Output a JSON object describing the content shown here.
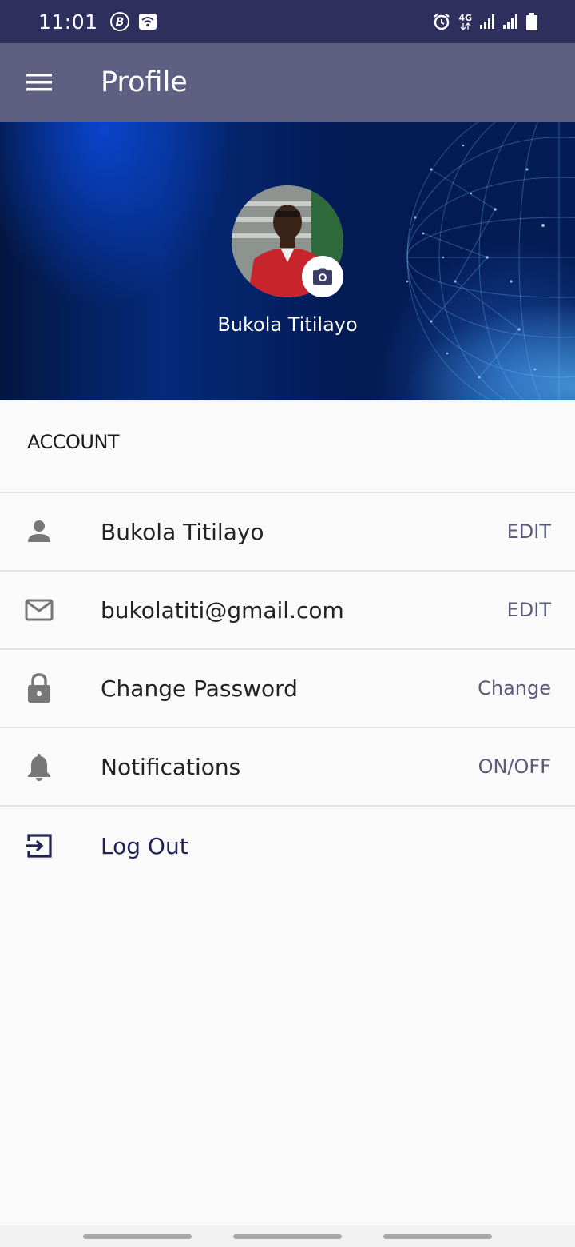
{
  "status_bar": {
    "time": "11:01",
    "network_label": "4G",
    "icons": [
      "b-circle-icon",
      "wifi-icon",
      "alarm-icon",
      "network-4g-icon",
      "signal-icon",
      "signal-icon",
      "battery-icon"
    ]
  },
  "app_bar": {
    "title": "Profile",
    "menu_icon": "hamburger-menu-icon"
  },
  "banner": {
    "user_name": "Bukola Titilayo",
    "camera_icon": "camera-icon"
  },
  "account": {
    "section_title": "ACCOUNT",
    "items": [
      {
        "icon": "person-icon",
        "label": "Bukola Titilayo",
        "action": "EDIT"
      },
      {
        "icon": "mail-icon",
        "label": "bukolatiti@gmail.com",
        "action": "EDIT"
      },
      {
        "icon": "lock-icon",
        "label": "Change Password",
        "action": "Change"
      },
      {
        "icon": "bell-icon",
        "label": "Notifications",
        "action": "ON/OFF"
      },
      {
        "icon": "logout-icon",
        "label": "Log Out",
        "action": ""
      }
    ]
  },
  "colors": {
    "status_bar_bg": "#2e2f5d",
    "app_bar_bg": "#5f5f82",
    "action_text": "#5a5a7a",
    "page_bg": "#fafafa"
  }
}
